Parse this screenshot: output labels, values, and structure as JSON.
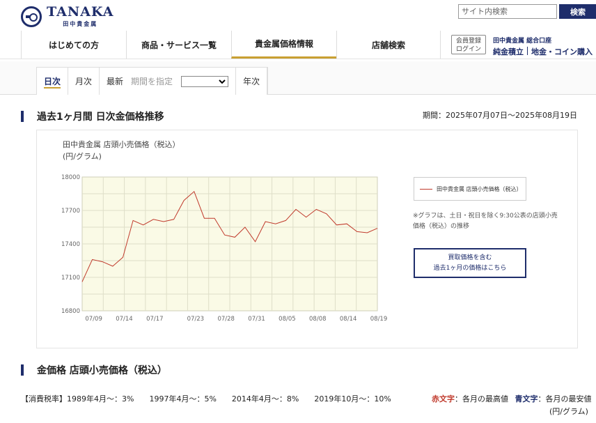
{
  "header": {
    "logo_name": "TANAKA",
    "logo_sub": "田中貴金属",
    "search_placeholder": "サイト内検索",
    "search_button": "検索"
  },
  "nav": {
    "items": [
      "はじめての方",
      "商品・サービス一覧",
      "貴金属価格情報",
      "店舗検索"
    ],
    "active_index": 2,
    "member_line1": "会員登録",
    "member_line2": "ログイン",
    "corp_title": "田中貴金属 総合口座",
    "corp_link1": "純金積立",
    "corp_link2": "地金・コイン購入"
  },
  "tabs": {
    "daily": "日次",
    "monthly": "月次",
    "latest": "最新",
    "period": "期間を指定",
    "yearly": "年次"
  },
  "section1": {
    "title": "過去1ヶ月間 日次金価格推移",
    "period": "期間：2025年07月07日〜2025年08月19日"
  },
  "chart_panel": {
    "title": "田中貴金属 店頭小売価格（税込）",
    "unit": "(円/グラム)",
    "legend": "田中貴金属 店頭小売価格（税込）",
    "note": "※グラフは、土日・祝日を除く9:30公表の店頭小売価格（税込）の推移",
    "buyback_line1": "買取価格を含む",
    "buyback_line2": "過去1ヶ月の価格はこちら"
  },
  "section2": {
    "title": "金価格 店頭小売価格（税込）"
  },
  "tax": {
    "label": "【消費税率】1989年4月〜：3%",
    "r2": "1997年4月〜：5%",
    "r3": "2014年4月〜：8%",
    "r4": "2019年10月〜：10%"
  },
  "legend2": {
    "red_label": "赤文字",
    "red_desc": "：各月の最高値",
    "blue_label": "青文字",
    "blue_desc": "：各月の最安値",
    "unit": "(円/グラム)"
  },
  "chart_data": {
    "type": "line",
    "title": "田中貴金属 店頭小売価格（税込）",
    "ylabel": "(円/グラム)",
    "ylim": [
      16800,
      18000
    ],
    "yticks": [
      16800,
      17100,
      17400,
      17700,
      18000
    ],
    "xtick_labels": [
      "07/09",
      "07/14",
      "07/17",
      "07/23",
      "07/28",
      "07/31",
      "08/05",
      "08/08",
      "08/14",
      "08/19"
    ],
    "xtick_indices": [
      2,
      5,
      8,
      12,
      15,
      18,
      21,
      24,
      27,
      30
    ],
    "grid": true,
    "legend_position": "right",
    "series": [
      {
        "name": "田中貴金属 店頭小売価格（税込）",
        "color": "#c0392b",
        "values": [
          17060,
          17260,
          17240,
          17200,
          17280,
          17610,
          17570,
          17620,
          17600,
          17620,
          17790,
          17870,
          17630,
          17630,
          17480,
          17460,
          17550,
          17420,
          17600,
          17580,
          17610,
          17710,
          17640,
          17710,
          17670,
          17570,
          17580,
          17510,
          17500,
          17540
        ]
      }
    ]
  }
}
